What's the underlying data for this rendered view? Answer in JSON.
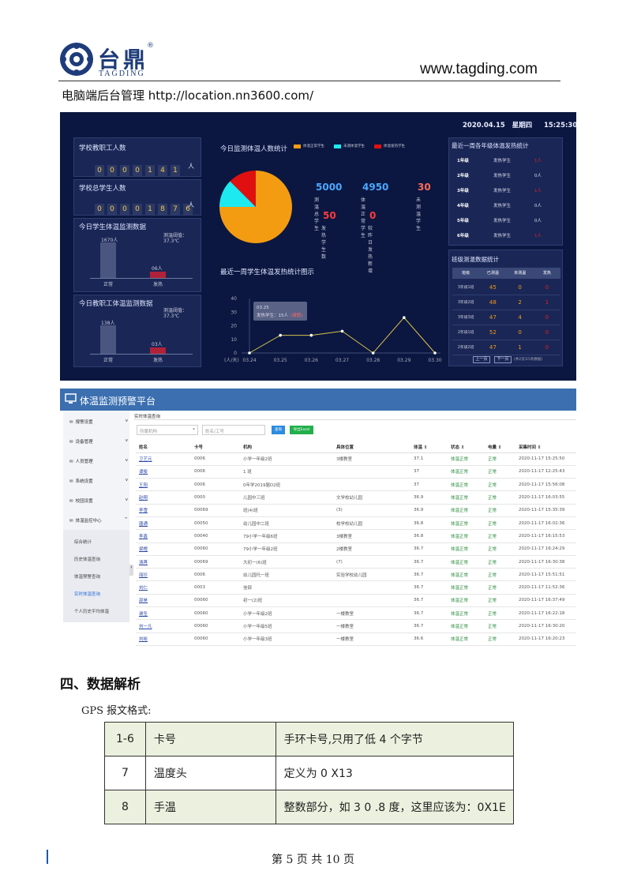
{
  "header": {
    "brand_cn": "台鼎",
    "brand_reg": "®",
    "brand_en": "TAGDING",
    "site": "www.tagding.com",
    "intro": "电脑端后台管理 http://location.nn3600.com/"
  },
  "dashboard": {
    "datetime": "2020.04.15   星期四     15:25:30",
    "staff_total_label": "学校教职工人数",
    "staff_total_digits": [
      "0",
      "0",
      "0",
      "0",
      "1",
      "4",
      "1"
    ],
    "unit": "人",
    "student_total_label": "学校总学生人数",
    "student_total_digits": [
      "0",
      "0",
      "0",
      "0",
      "1",
      "8",
      "7",
      "6"
    ],
    "student_today_title": "今日学生体温监测数据",
    "student_threshold": "测温阈值：37.3℃",
    "student_normal_val": "1670人",
    "student_fever_val": "06人",
    "normal_label": "正常",
    "fever_label": "发热",
    "staff_today_title": "今日教职工体温监测数据",
    "staff_threshold": "测温阈值：37.3℃",
    "staff_normal_val": "138人",
    "staff_fever_val": "03人",
    "pie_title": "今日监测体温人数统计",
    "legend": [
      "体温正常学生",
      "未测体温学生",
      "体温发热学生"
    ],
    "legend_colors": [
      "#f39c12",
      "#1de9f0",
      "#e01010"
    ],
    "stats": [
      {
        "value": "5000",
        "label": "测温总学生",
        "color": "#4aa8ff"
      },
      {
        "value": "4950",
        "label": "体温正常学生",
        "color": "#4aa8ff"
      },
      {
        "value": "30",
        "label": "未测温学生",
        "color": "#ff6b5a"
      },
      {
        "value": "50",
        "label": "发热学生数",
        "color": "#ff3b3b"
      },
      {
        "value": "0",
        "label": "较昨日发热新增",
        "color": "#ff3b3b"
      }
    ],
    "line_title": "最近一周学生体温发热统计图示",
    "line_unit": "(人/天)",
    "tooltip_date": "03.25",
    "tooltip_text": "发热学生：15人",
    "tooltip_status": "(请假)",
    "grade_title": "最近一周各年级体温发热统计",
    "grades": [
      {
        "grade": "1年级",
        "label": "发热学生",
        "val": "1人",
        "red": true
      },
      {
        "grade": "2年级",
        "label": "发热学生",
        "val": "0人",
        "red": false
      },
      {
        "grade": "3年级",
        "label": "发热学生",
        "val": "1人",
        "red": true
      },
      {
        "grade": "4年级",
        "label": "发热学生",
        "val": "0人",
        "red": false
      },
      {
        "grade": "5年级",
        "label": "发热学生",
        "val": "0人",
        "red": false
      },
      {
        "grade": "6年级",
        "label": "发热学生",
        "val": "1人",
        "red": true
      }
    ],
    "class_title": "班级测温数据统计",
    "class_headers": [
      "班级",
      "已测温",
      "未测温",
      "发热"
    ],
    "classes": [
      [
        "3年级1班",
        "45",
        "0",
        "0"
      ],
      [
        "3年级2班",
        "48",
        "2",
        "1"
      ],
      [
        "3年级3班",
        "47",
        "4",
        "0"
      ],
      [
        "2年级1班",
        "52",
        "0",
        "0"
      ],
      [
        "2年级2班",
        "47",
        "1",
        "0"
      ]
    ],
    "pager": {
      "prev": "上一页",
      "next": "下一页",
      "info": "(共2页/15条数据)"
    }
  },
  "chart_data": {
    "type": "line",
    "x": [
      "03.24",
      "03.25",
      "03.26",
      "03.27",
      "03.28",
      "03.29",
      "03.30"
    ],
    "series": [
      {
        "values": [
          0,
          13,
          13,
          16,
          0,
          26,
          0
        ]
      }
    ],
    "ylim": [
      0,
      40
    ],
    "yticks": [
      0,
      10,
      20,
      30,
      40
    ],
    "pie": [
      {
        "label": "体温正常学生",
        "value": 4950
      },
      {
        "label": "未测体温学生",
        "value": 30
      },
      {
        "label": "体温发热学生",
        "value": 50
      }
    ],
    "bars_student": [
      1670,
      6
    ],
    "bars_staff": [
      138,
      3
    ]
  },
  "platform": {
    "title": "体温监测预警平台",
    "menu": [
      "报警设置",
      "设备管理",
      "人员管理",
      "系统设置",
      "校园设置",
      "体温监控中心"
    ],
    "submenu": [
      "综合统计",
      "历史体温查询",
      "体温预警查询",
      "实时体温查询",
      "个人历史平均体温"
    ],
    "query_title": "实时体温查询",
    "select_placeholder": "所属机构",
    "input_placeholder": "姓名/工号",
    "btn_query": "查询",
    "btn_export": "导出Excel",
    "columns": [
      "姓名",
      "卡号",
      "机构",
      "具体位置",
      "体温 ⇕",
      "状态 ⇕",
      "电量 ⇕",
      "采集时间 ⇕"
    ],
    "rows": [
      [
        "卫艺元",
        "0006",
        "小学一年级2班",
        "3楼教室",
        "37.1",
        "体温正常",
        "正常",
        "2020-11-17 15:25:50"
      ],
      [
        "谭俊",
        "0006",
        "1 班",
        "",
        "37",
        "体温正常",
        "正常",
        "2020-11-17 12:25:43"
      ],
      [
        "王阳",
        "0006",
        "0年学2019届D2班",
        "",
        "37",
        "体温正常",
        "正常",
        "2020-11-17 15:56:08"
      ],
      [
        "赵翔",
        "0000",
        "儿园中三班",
        "文学校幼儿园",
        "36.9",
        "体温正常",
        "正常",
        "2020-11-17 16:03:55"
      ],
      [
        "李雪",
        "00069",
        "班(4)班",
        "(3)",
        "36.9",
        "体温正常",
        "正常",
        "2020-11-17 15:35:39"
      ],
      [
        "唐通",
        "00050",
        "幼儿园中二班",
        "校学校幼儿园",
        "36.8",
        "体温正常",
        "正常",
        "2020-11-17 16:02:36"
      ],
      [
        "李鑫",
        "00040",
        "79小学一年级6班",
        "3楼教室",
        "36.8",
        "体温正常",
        "正常",
        "2020-11-17 16:15:53"
      ],
      [
        "梁橙",
        "00060",
        "79小学一年级2班",
        "2楼教室",
        "36.7",
        "体温正常",
        "正常",
        "2020-11-17 16:24:29"
      ],
      [
        "清苒",
        "00069",
        "大初一(6)班",
        "(7)",
        "36.7",
        "体温正常",
        "正常",
        "2020-11-17 16:30:38"
      ],
      [
        "丽珍",
        "0006",
        "幼儿园托一班",
        "实验学校幼儿园",
        "36.7",
        "体温正常",
        "正常",
        "2020-11-17 15:51:51"
      ],
      [
        "刘仁",
        "0003",
        "信部",
        "",
        "36.7",
        "体温正常",
        "正常",
        "2020-11-17 11:52:36"
      ],
      [
        "邵昊",
        "00060",
        "初一(2)班",
        "",
        "36.7",
        "体温正常",
        "正常",
        "2020-11-17 16:37:49"
      ],
      [
        "谢圣",
        "00060",
        "小学一年级2班",
        "一楼教室",
        "36.7",
        "体温正常",
        "正常",
        "2020-11-17 16:22:18"
      ],
      [
        "刘一凡",
        "00060",
        "小学一年级5班",
        "一楼教室",
        "36.7",
        "体温正常",
        "正常",
        "2020-11-17 16:30:20"
      ],
      [
        "刘彬",
        "00060",
        "小学一年级3班",
        "一楼教室",
        "36.6",
        "体温正常",
        "正常",
        "2020-11-17 16:20:23"
      ]
    ]
  },
  "section": {
    "title": "四、数据解析",
    "gps": "GPS 报文格式:"
  },
  "spec": [
    [
      "1-6",
      "卡号",
      "手环卡号,只用了低 4 个字节"
    ],
    [
      "7",
      "温度头",
      "定义为 0 X13"
    ],
    [
      "8",
      "手温",
      "整数部分，如 3 0 .8 度，这里应该为：0X1E"
    ]
  ],
  "footer": "第 5 页 共 10 页"
}
